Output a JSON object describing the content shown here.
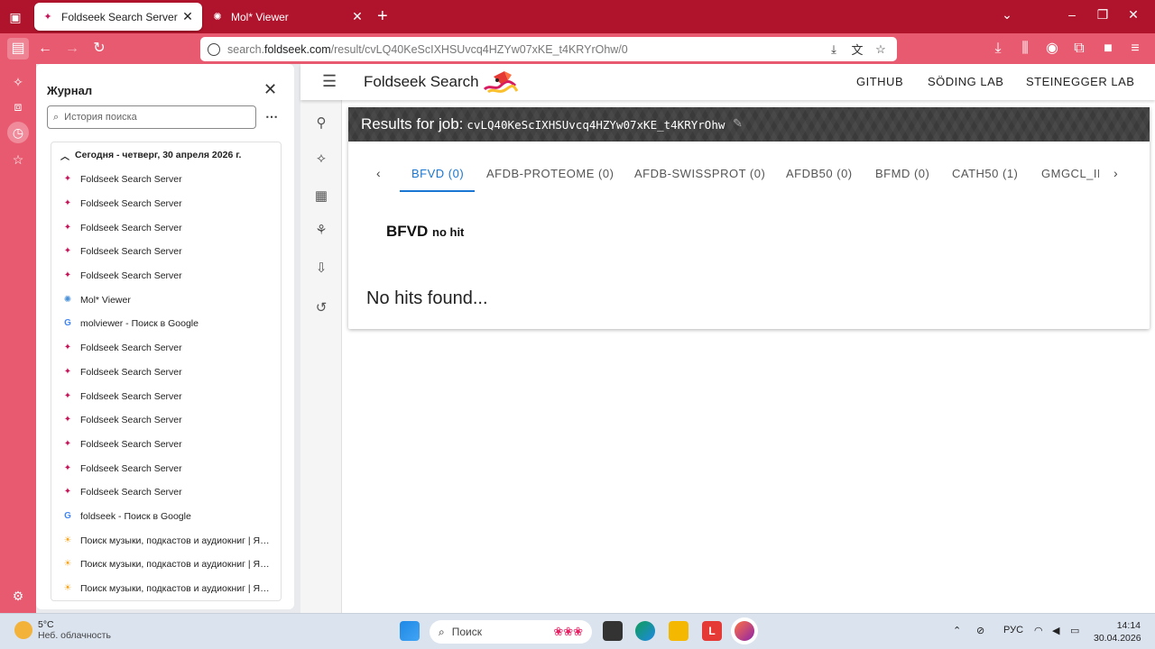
{
  "browser": {
    "tabs": [
      {
        "label": "Foldseek Search Server",
        "icon": "foldseek-favicon",
        "active": true
      },
      {
        "label": "Mol* Viewer",
        "icon": "molstar-favicon",
        "active": false
      }
    ],
    "url_prefix": "search.",
    "url_domain": "foldseek.com",
    "url_path": "/result/cvLQ40KeScIXHSUvcq4HZYw07xKE_t4KRYrOhw/0",
    "accent": "#b0142c"
  },
  "history": {
    "title": "Журнал",
    "search_placeholder": "История поиска",
    "group_label": "Сегодня - четверг, 30 апреля 2026 г.",
    "items": [
      {
        "label": "Foldseek Search Server",
        "icon": "foldseek"
      },
      {
        "label": "Foldseek Search Server",
        "icon": "foldseek"
      },
      {
        "label": "Foldseek Search Server",
        "icon": "foldseek"
      },
      {
        "label": "Foldseek Search Server",
        "icon": "foldseek"
      },
      {
        "label": "Foldseek Search Server",
        "icon": "foldseek"
      },
      {
        "label": "Mol* Viewer",
        "icon": "molstar"
      },
      {
        "label": "molviewer - Поиск в Google",
        "icon": "google"
      },
      {
        "label": "Foldseek Search Server",
        "icon": "foldseek"
      },
      {
        "label": "Foldseek Search Server",
        "icon": "foldseek"
      },
      {
        "label": "Foldseek Search Server",
        "icon": "foldseek"
      },
      {
        "label": "Foldseek Search Server",
        "icon": "foldseek"
      },
      {
        "label": "Foldseek Search Server",
        "icon": "foldseek"
      },
      {
        "label": "Foldseek Search Server",
        "icon": "foldseek"
      },
      {
        "label": "Foldseek Search Server",
        "icon": "foldseek"
      },
      {
        "label": "foldseek - Поиск в Google",
        "icon": "google"
      },
      {
        "label": "Поиск музыки, подкастов и аудиокниг | Яндекс Музыка",
        "icon": "yandex"
      },
      {
        "label": "Поиск музыки, подкастов и аудиокниг | Яндекс Музыка",
        "icon": "yandex"
      },
      {
        "label": "Поиск музыки, подкастов и аудиокниг | Яндекс Музыка",
        "icon": "yandex"
      }
    ]
  },
  "app": {
    "brand": "Foldseek Search",
    "nav": [
      "GITHUB",
      "SÖDING LAB",
      "STEINEGGER LAB"
    ],
    "results_label": "Results for job:",
    "job_id": "cvLQ40KeScIXHSUvcq4HZYw07xKE_t4KRYrOhw",
    "db_tabs": [
      "BFVD (0)",
      "AFDB-PROTEOME (0)",
      "AFDB-SWISSPROT (0)",
      "AFDB50 (0)",
      "BFMD (0)",
      "CATH50 (1)",
      "GMGCL_ID"
    ],
    "active_tab": "BFVD (0)",
    "db_name": "BFVD",
    "db_status": "no hit",
    "empty_message": "No hits found...",
    "accent": "#1976d2"
  },
  "taskbar": {
    "temp": "5°C",
    "weather": "Неб. облачность",
    "search_label": "Поиск",
    "lang": "РУС",
    "time": "14:14",
    "date": "30.04.2026"
  }
}
